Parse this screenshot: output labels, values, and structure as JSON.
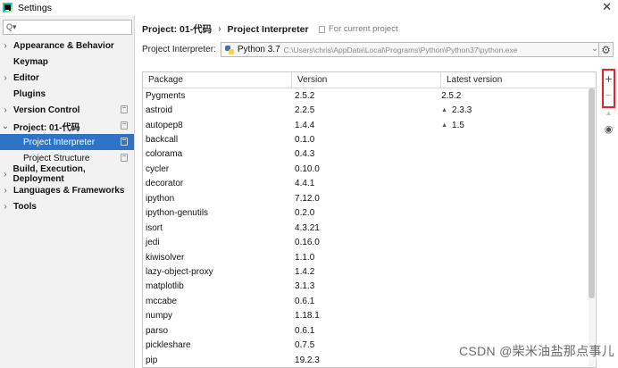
{
  "window": {
    "title": "Settings"
  },
  "sidebar": {
    "search_placeholder": "",
    "items": [
      {
        "label": "Appearance & Behavior",
        "arrow": "›",
        "bold": true
      },
      {
        "label": "Keymap",
        "arrow": "",
        "bold": true
      },
      {
        "label": "Editor",
        "arrow": "›",
        "bold": true
      },
      {
        "label": "Plugins",
        "arrow": "",
        "bold": true
      },
      {
        "label": "Version Control",
        "arrow": "›",
        "bold": true
      },
      {
        "label": "Project: 01-代码",
        "arrow": "⌄",
        "bold": true
      },
      {
        "label": "Project Interpreter",
        "child": true,
        "selected": true
      },
      {
        "label": "Project Structure",
        "child": true
      },
      {
        "label": "Build, Execution, Deployment",
        "arrow": "›",
        "bold": true
      },
      {
        "label": "Languages & Frameworks",
        "arrow": "›",
        "bold": true
      },
      {
        "label": "Tools",
        "arrow": "›",
        "bold": true
      }
    ]
  },
  "header": {
    "crumb_project": "Project: 01-代码",
    "crumb_sep": "›",
    "crumb_page": "Project Interpreter",
    "for_current": "For current project"
  },
  "interpreter": {
    "label": "Project Interpreter:",
    "name": "Python 3.7",
    "path": "C:\\Users\\chris\\AppData\\Local\\Programs\\Python\\Python37\\python.exe"
  },
  "table": {
    "headers": [
      "Package",
      "Version",
      "Latest version"
    ],
    "rows": [
      {
        "package": "Pygments",
        "version": "2.5.2",
        "latest": "2.5.2",
        "upgrade": false
      },
      {
        "package": "astroid",
        "version": "2.2.5",
        "latest": "2.3.3",
        "upgrade": true
      },
      {
        "package": "autopep8",
        "version": "1.4.4",
        "latest": "1.5",
        "upgrade": true
      },
      {
        "package": "backcall",
        "version": "0.1.0",
        "latest": "",
        "upgrade": false
      },
      {
        "package": "colorama",
        "version": "0.4.3",
        "latest": "",
        "upgrade": false
      },
      {
        "package": "cycler",
        "version": "0.10.0",
        "latest": "",
        "upgrade": false
      },
      {
        "package": "decorator",
        "version": "4.4.1",
        "latest": "",
        "upgrade": false
      },
      {
        "package": "ipython",
        "version": "7.12.0",
        "latest": "",
        "upgrade": false
      },
      {
        "package": "ipython-genutils",
        "version": "0.2.0",
        "latest": "",
        "upgrade": false
      },
      {
        "package": "isort",
        "version": "4.3.21",
        "latest": "",
        "upgrade": false
      },
      {
        "package": "jedi",
        "version": "0.16.0",
        "latest": "",
        "upgrade": false
      },
      {
        "package": "kiwisolver",
        "version": "1.1.0",
        "latest": "",
        "upgrade": false
      },
      {
        "package": "lazy-object-proxy",
        "version": "1.4.2",
        "latest": "",
        "upgrade": false
      },
      {
        "package": "matplotlib",
        "version": "3.1.3",
        "latest": "",
        "upgrade": false
      },
      {
        "package": "mccabe",
        "version": "0.6.1",
        "latest": "",
        "upgrade": false
      },
      {
        "package": "numpy",
        "version": "1.18.1",
        "latest": "",
        "upgrade": false
      },
      {
        "package": "parso",
        "version": "0.6.1",
        "latest": "",
        "upgrade": false
      },
      {
        "package": "pickleshare",
        "version": "0.7.5",
        "latest": "",
        "upgrade": false
      },
      {
        "package": "pip",
        "version": "19.2.3",
        "latest": "",
        "upgrade": false
      }
    ]
  },
  "toolbar": {
    "add": "+",
    "remove": "−",
    "upgrade": "▲",
    "show_early": "👁"
  },
  "icons": {
    "app": "pycharm-icon",
    "search": "search-icon",
    "gear": "gear-icon",
    "upgrade_arrow": "upgrade-arrow-icon"
  },
  "colors": {
    "selection": "#2f73c6",
    "highlight_box": "#e8202a"
  },
  "watermark": "CSDN @柴米油盐那点事儿"
}
